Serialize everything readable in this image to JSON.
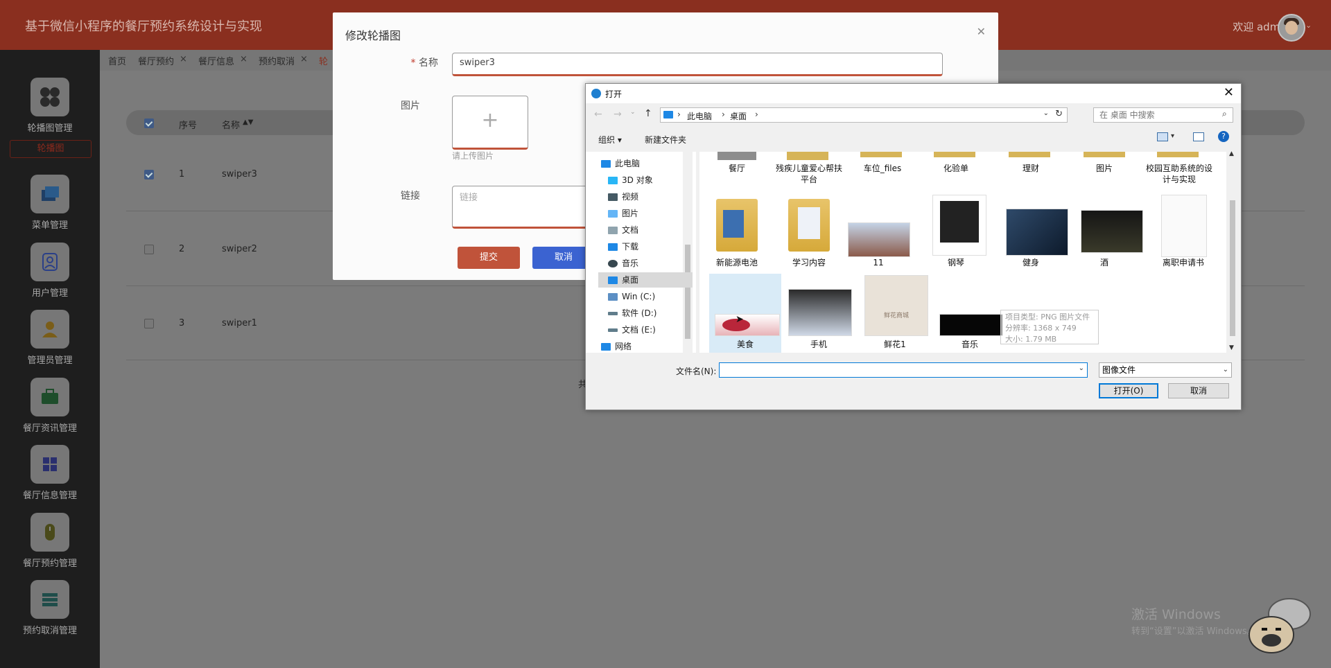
{
  "header": {
    "title": "基于微信小程序的餐厅预约系统设计与实现",
    "welcome": "欢迎 admin"
  },
  "sidebar": {
    "items": [
      {
        "label": "轮播图管理",
        "icon": "grid-icon"
      },
      {
        "label": "菜单管理",
        "icon": "stack-icon"
      },
      {
        "label": "用户管理",
        "icon": "user-icon"
      },
      {
        "label": "管理员管理",
        "icon": "admin-icon"
      },
      {
        "label": "餐厅资讯管理",
        "icon": "briefcase-icon"
      },
      {
        "label": "餐厅信息管理",
        "icon": "windows-icon"
      },
      {
        "label": "餐厅预约管理",
        "icon": "mouse-icon"
      },
      {
        "label": "预约取消管理",
        "icon": "list-icon"
      }
    ],
    "active_sub": "轮播图"
  },
  "tabs": [
    {
      "label": "首页",
      "closable": false
    },
    {
      "label": "餐厅预约",
      "closable": true
    },
    {
      "label": "餐厅信息",
      "closable": true
    },
    {
      "label": "预约取消",
      "closable": true
    },
    {
      "label": "轮",
      "closable": false
    }
  ],
  "table": {
    "headers": {
      "index": "序号",
      "name": "名称"
    },
    "rows": [
      {
        "index": "1",
        "name": "swiper3",
        "checked": true
      },
      {
        "index": "2",
        "name": "swiper2",
        "checked": false
      },
      {
        "index": "3",
        "name": "swiper1",
        "checked": false
      }
    ],
    "footer_partial": "共"
  },
  "edit_dialog": {
    "title": "修改轮播图",
    "name_label": "名称",
    "name_value": "swiper3",
    "image_label": "图片",
    "upload_hint": "请上传图片",
    "link_label": "链接",
    "link_placeholder": "链接",
    "submit": "提交",
    "cancel": "取消"
  },
  "file_dialog": {
    "title": "打开",
    "path": [
      "此电脑",
      "桌面"
    ],
    "search_placeholder": "在 桌面 中搜索",
    "organize": "组织",
    "new_folder": "新建文件夹",
    "nav": [
      "此电脑",
      "3D 对象",
      "视频",
      "图片",
      "文档",
      "下载",
      "音乐",
      "桌面",
      "Win (C:)",
      "软件 (D:)",
      "文档 (E:)",
      "网络"
    ],
    "row1": [
      "餐厅",
      "残疾儿童爱心帮扶平台",
      "车位_files",
      "化验单",
      "理财",
      "图片",
      "校园互助系统的设计与实现"
    ],
    "row2": [
      "新能源电池",
      "学习内容",
      "11",
      "钢琴",
      "健身",
      "酒",
      "离职申请书"
    ],
    "row3": [
      "美食",
      "手机",
      "鲜花1",
      "音乐"
    ],
    "flower_shop_text": "鲜花商城",
    "tooltip": {
      "line1": "项目类型: PNG 图片文件",
      "line2": "分辨率: 1368 x 749",
      "line3": "大小: 1.79 MB"
    },
    "filename_label": "文件名(N):",
    "filetype": "图像文件",
    "open": "打开(O)",
    "cancel": "取消"
  },
  "watermark": {
    "line1": "激活 Windows",
    "line2": "转到“设置”以激活 Windows。"
  },
  "colors": {
    "header": "#8a2f1f",
    "sidebar": "#1e1e1e",
    "submit": "#c0533a",
    "cancel": "#3b63d1"
  }
}
